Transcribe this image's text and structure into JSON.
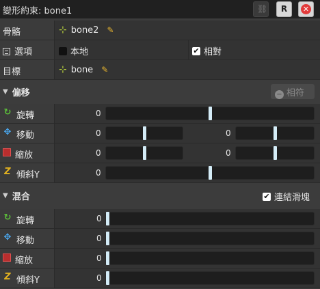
{
  "window": {
    "title": "變形約束: bone1"
  },
  "toolbar": {
    "r_button_label": "R",
    "close_label": "✕"
  },
  "props": {
    "bone": {
      "label": "骨骼",
      "value": "bone2"
    },
    "options": {
      "label": "選項",
      "local_label": "本地",
      "local_checked": false,
      "relative_label": "相對",
      "relative_checked": true
    },
    "target": {
      "label": "目標",
      "value": "bone"
    }
  },
  "offset": {
    "title": "偏移",
    "relative_button": "相符",
    "rows": {
      "rotate": {
        "label": "旋轉",
        "value": "0",
        "knob": 0.5
      },
      "translate": {
        "label": "移動",
        "x": "0",
        "y": "0",
        "knob_x": 0.5,
        "knob_y": 0.5
      },
      "scale": {
        "label": "縮放",
        "x": "0",
        "y": "0",
        "knob_x": 0.5,
        "knob_y": 0.5
      },
      "shear": {
        "label": "傾斜Y",
        "value": "0",
        "knob": 0.5
      }
    }
  },
  "mix": {
    "title": "混合",
    "chain_label": "連結滑塊",
    "chain_checked": true,
    "rows": {
      "rotate": {
        "label": "旋轉",
        "value": "0",
        "knob": 0
      },
      "translate": {
        "label": "移動",
        "value": "0",
        "knob": 0
      },
      "scale": {
        "label": "縮放",
        "value": "0",
        "knob": 0
      },
      "shear": {
        "label": "傾斜Y",
        "value": "0",
        "knob": 0
      }
    }
  },
  "icons": {
    "bone": "bone-icon",
    "pencil": "pencil-icon",
    "list": "list-icon",
    "rotate": "rotate-icon",
    "translate": "translate-icon",
    "scale": "scale-icon",
    "shear": "shear-icon"
  },
  "colors": {
    "accent_knob": "#d4ecf7",
    "close": "#e23b3b",
    "rotate": "#5cbf3a",
    "translate": "#4aa4e8",
    "shear": "#e0b020"
  }
}
